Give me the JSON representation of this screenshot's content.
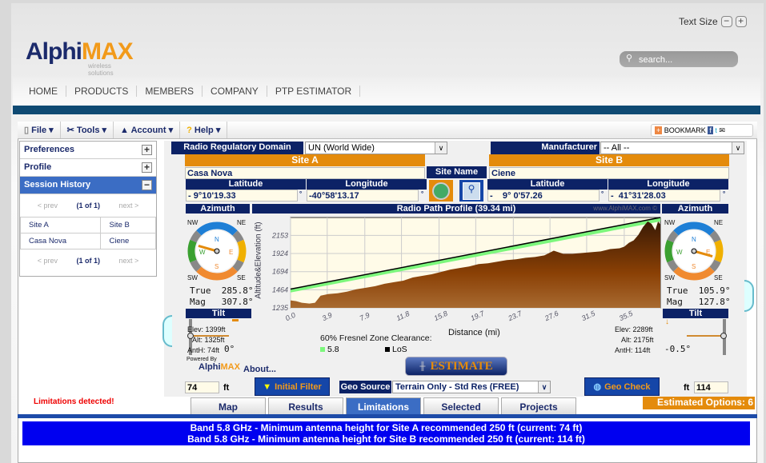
{
  "header": {
    "logo_a": "Alphi",
    "logo_b": "MAX",
    "logo_tag": "wireless solutions",
    "text_size": "Text Size",
    "minus": "−",
    "plus": "+",
    "search_placeholder": "search..."
  },
  "nav": [
    "HOME",
    "PRODUCTS",
    "MEMBERS",
    "COMPANY",
    "PTP ESTIMATOR"
  ],
  "menu": {
    "file": "File ▾",
    "tools": "Tools ▾",
    "account": "Account ▾",
    "help": "Help ▾",
    "bookmark": "BOOKMARK"
  },
  "sidebar": {
    "preferences": "Preferences",
    "profile": "Profile",
    "session_history": "Session History",
    "prev": "< prev",
    "page": "(1 of 1)",
    "next": "next >",
    "col_a": "Site A",
    "col_b": "Site B",
    "row_a": "Casa Nova",
    "row_b": "Ciene"
  },
  "form": {
    "domain_label": "Radio Regulatory Domain",
    "domain_value": "UN (World Wide)",
    "manufacturer_label": "Manufacturer",
    "manufacturer_value": "-- All --",
    "site_a": "Site A",
    "site_b": "Site B",
    "site_name": "Site Name",
    "site_a_name": "Casa Nova",
    "site_b_name": "Ciene",
    "latitude": "Latitude",
    "longitude": "Longitude",
    "a_lat": "-  9°10'19.33",
    "a_lon": "-40°58'13.17",
    "b_lat": "-    9° 0'57.26",
    "b_lon": "-  41°31'28.03",
    "deg": "°"
  },
  "azimuth": {
    "label": "Azimuth",
    "a_true": "True  285.8°",
    "a_mag": "Mag   307.8°",
    "b_true": "True  105.9°",
    "b_mag": "Mag   127.8°",
    "compass": [
      "NW",
      "NE",
      "SW",
      "SE",
      "N",
      "S",
      "E",
      "W"
    ]
  },
  "tilt": {
    "label": "Tilt",
    "a": "0°",
    "b": "-0.5°"
  },
  "site_stats": {
    "a_elev": "Elev: 1399ft",
    "a_alt": "Alt: 1325ft",
    "a_anth": "AntH: 74ft",
    "b_elev": "Elev: 2289ft",
    "b_alt": "Alt: 2175ft",
    "b_anth": "AntH: 114ft"
  },
  "chart_data": {
    "type": "area",
    "title": "Radio Path Profile (39.34 mi)",
    "watermark": "www.AlphiMAX.com ©",
    "xlabel": "Distance (mi)",
    "ylabel": "Altitude&Elevation (ft)",
    "xlim": [
      0,
      39.34
    ],
    "ylim": [
      1235,
      2380
    ],
    "xticks": [
      "0.0",
      "3.9",
      "7.9",
      "11.8",
      "15.8",
      "19.7",
      "23.7",
      "27.6",
      "31.5",
      "35.5"
    ],
    "yticks": [
      "1235",
      "1464",
      "1694",
      "1924",
      "2153"
    ],
    "terrain": {
      "x": [
        0,
        0.6,
        1.2,
        2,
        2.6,
        3.2,
        4,
        5,
        6,
        7,
        8,
        9,
        10,
        11,
        12,
        13,
        14,
        15,
        16,
        17,
        18,
        19,
        20,
        21,
        22,
        23,
        24,
        25,
        26,
        27,
        28,
        29,
        30,
        31,
        32,
        33,
        34,
        35,
        35.5,
        36,
        36.5,
        37,
        37.5,
        38,
        38.4,
        38.8,
        39.1,
        39.34
      ],
      "y": [
        1330,
        1320,
        1300,
        1290,
        1300,
        1390,
        1410,
        1420,
        1440,
        1470,
        1490,
        1510,
        1540,
        1560,
        1580,
        1620,
        1640,
        1660,
        1690,
        1720,
        1740,
        1760,
        1790,
        1800,
        1820,
        1840,
        1850,
        1870,
        1880,
        1900,
        1960,
        1920,
        1920,
        1930,
        1940,
        1950,
        1980,
        1990,
        2010,
        2060,
        2090,
        2160,
        2260,
        2330,
        2300,
        2220,
        2330,
        2289
      ]
    },
    "los": {
      "x": [
        0,
        39.34
      ],
      "y": [
        1473,
        2380
      ]
    },
    "fresnel_bottom": {
      "x": [
        0,
        39.34
      ],
      "y": [
        1430,
        2330
      ]
    },
    "legend_title": "60% Fresnel Zone Clearance:",
    "legend": [
      {
        "name": "5.8",
        "color": "#7cf77c"
      },
      {
        "name": "LoS",
        "color": "#000000"
      }
    ]
  },
  "bottom": {
    "powered_by": "Powered By",
    "about": "About...",
    "a_height": "74",
    "b_height": "114",
    "ft": "ft",
    "initial_filter": "Initial Filter",
    "geo_source": "Geo Source",
    "geo_value": "Terrain Only - Std Res (FREE)",
    "geo_check": "Geo Check",
    "estimate": "ESTIMATE"
  },
  "tabs": [
    "Map",
    "Results",
    "Limitations",
    "Selected",
    "Projects"
  ],
  "limitations_detected": "Limitations detected!",
  "estimated_options": "Estimated Options: 6",
  "messages": [
    "Band 5.8 GHz - Minimum antenna height for Site A recommended 250 ft (current: 74 ft)",
    "Band 5.8 GHz - Minimum antenna height for Site B recommended 250 ft (current: 114 ft)"
  ]
}
